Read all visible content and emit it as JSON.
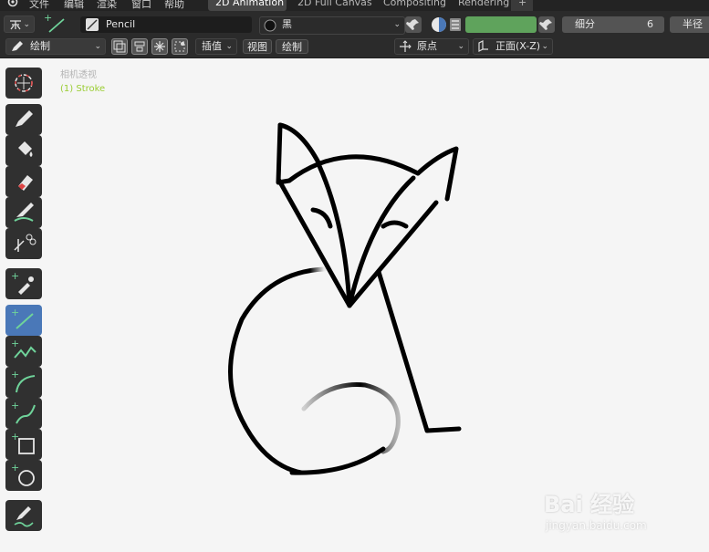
{
  "menubar": {
    "items": [
      "文件",
      "编辑",
      "渲染",
      "窗口",
      "帮助"
    ],
    "workspaces": [
      {
        "label": "2D Animation",
        "active": true
      },
      {
        "label": "2D Full Canvas",
        "active": false
      },
      {
        "label": "Compositing",
        "active": false
      },
      {
        "label": "Rendering",
        "active": false
      }
    ],
    "add_tab_label": "+"
  },
  "header": {
    "brush_name": "Pencil",
    "material_name": "黑",
    "color_hex": "#5fa35c",
    "subdivide_label": "细分",
    "subdivide_value": "6",
    "radius_label": "半径"
  },
  "header2": {
    "mode_label": "绘制",
    "interpolate_label": "插值",
    "view_label": "视图",
    "draw_label": "绘制",
    "origin_label": "原点",
    "front_view_label": "正面(X-Z)"
  },
  "viewport": {
    "camera_label": "相机透视",
    "object_label": "(1) Stroke",
    "watermark_top": "Bai 经验",
    "watermark_bottom": "jingyan.baidu.com"
  },
  "colors": {
    "accent": "#4a78b8",
    "object_label": "#9acd32",
    "tool_green": "#6fd39a"
  }
}
